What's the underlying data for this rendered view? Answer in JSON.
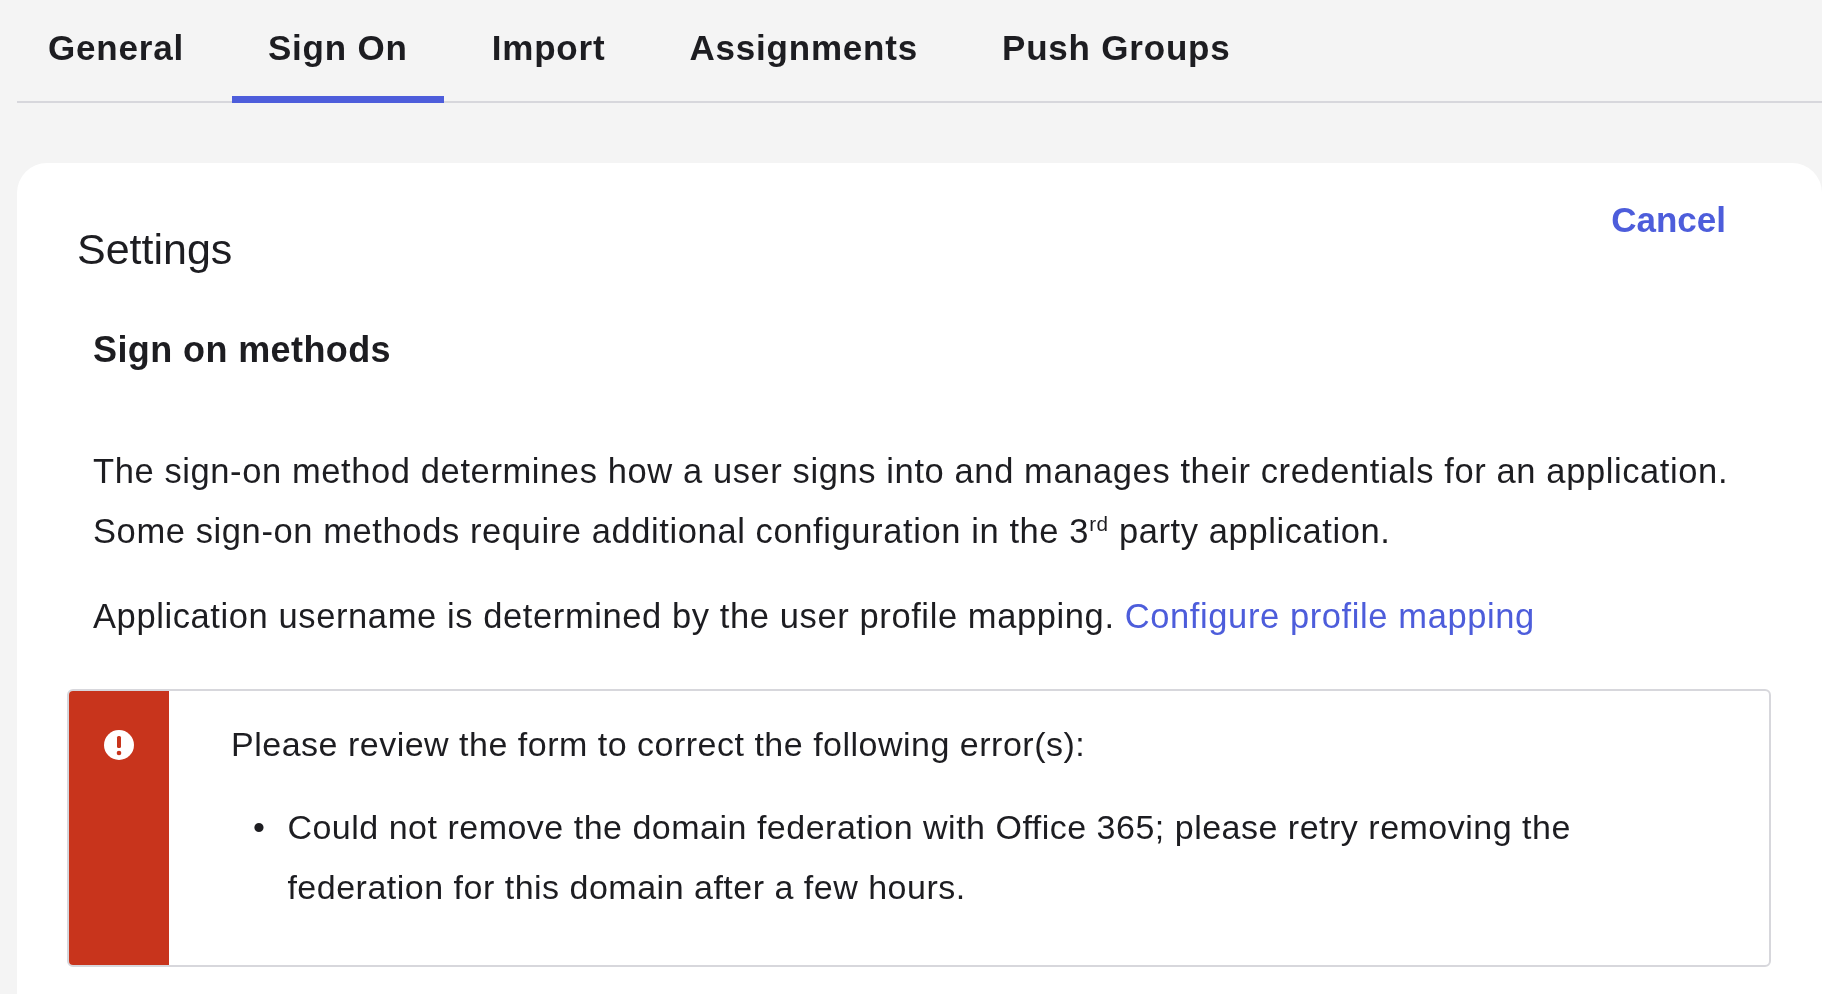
{
  "tabs": [
    {
      "label": "General",
      "selected": false
    },
    {
      "label": "Sign On",
      "selected": true
    },
    {
      "label": "Import",
      "selected": false
    },
    {
      "label": "Assignments",
      "selected": false
    },
    {
      "label": "Push Groups",
      "selected": false
    }
  ],
  "panel": {
    "title": "Settings",
    "cancel": "Cancel",
    "section": "Sign on methods",
    "description": "The sign-on method determines how a user signs into and manages their credentials for an application. Some sign-on methods require additional configuration in the 3$^{rd}$ party application.",
    "mapping_text": "Application username is determined by the user profile mapping.",
    "mapping_link": "Configure profile mapping",
    "error": {
      "heading": "Please review the form to correct the following error(s):",
      "items": [
        {
          "marker": "•",
          "text": "Could not remove the domain federation with Office 365; please retry removing the federation for this domain after a few hours."
        }
      ]
    }
  }
}
